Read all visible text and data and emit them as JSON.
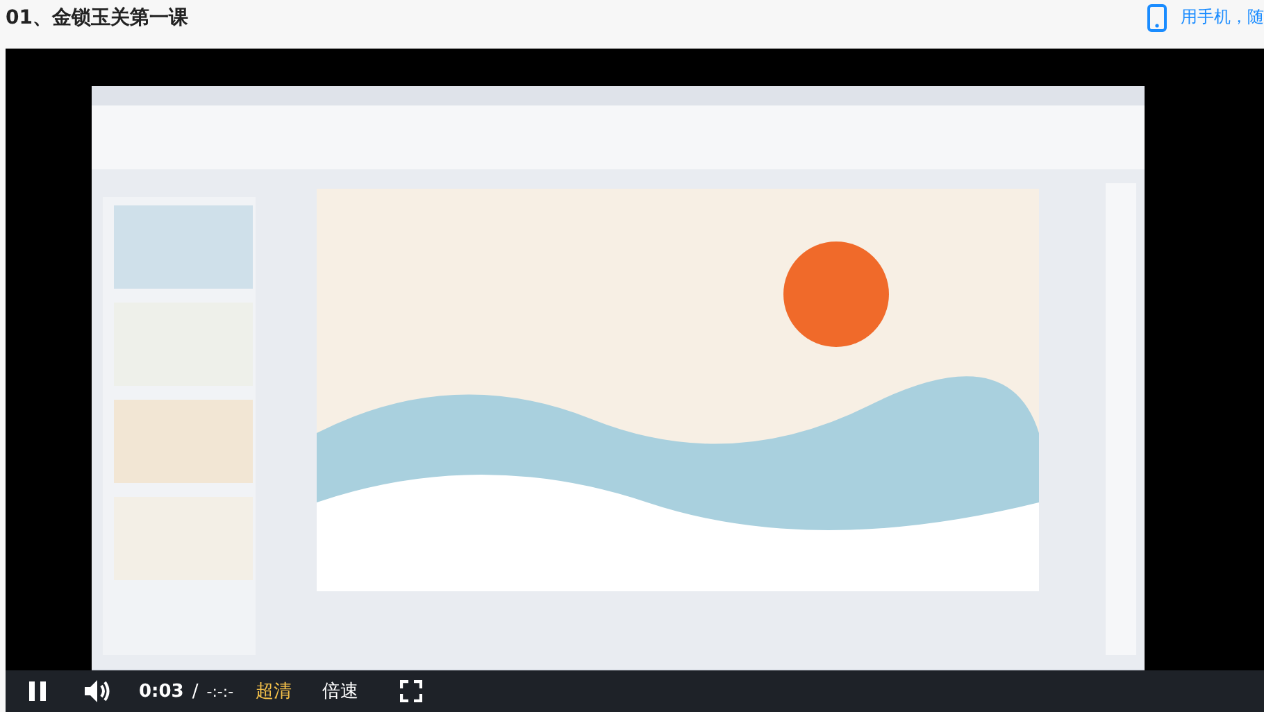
{
  "header": {
    "title": "01、金锁玉关第一课",
    "mobile_link": "用手机，随"
  },
  "player": {
    "controls": {
      "playing": true,
      "current_time": "0:03",
      "separator": "/",
      "duration": "-:-:-",
      "quality": "超清",
      "speed": "倍速"
    }
  }
}
